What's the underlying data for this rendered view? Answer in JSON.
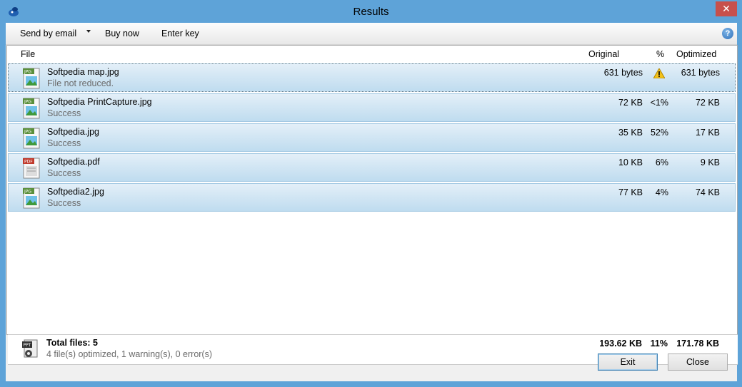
{
  "window": {
    "title": "Results",
    "close_label": "✕"
  },
  "toolbar": {
    "send_email": "Send by email",
    "buy_now": "Buy now",
    "enter_key": "Enter key",
    "help": "?"
  },
  "columns": {
    "file": "File",
    "original": "Original",
    "percent": "%",
    "optimized": "Optimized"
  },
  "files": [
    {
      "name": "Softpedia map.jpg",
      "status": "File not reduced.",
      "original": "631 bytes",
      "percent": "",
      "optimized": "631 bytes",
      "type": "JPG",
      "warning": true
    },
    {
      "name": "Softpedia PrintCapture.jpg",
      "status": "Success",
      "original": "72 KB",
      "percent": "<1%",
      "optimized": "72 KB",
      "type": "JPG"
    },
    {
      "name": "Softpedia.jpg",
      "status": "Success",
      "original": "35 KB",
      "percent": "52%",
      "optimized": "17 KB",
      "type": "JPG"
    },
    {
      "name": "Softpedia.pdf",
      "status": "Success",
      "original": "10 KB",
      "percent": "6%",
      "optimized": "9 KB",
      "type": "PDF"
    },
    {
      "name": "Softpedia2.jpg",
      "status": "Success",
      "original": "77 KB",
      "percent": "4%",
      "optimized": "74 KB",
      "type": "JPG"
    }
  ],
  "summary": {
    "total": "Total files: 5",
    "detail": "4 file(s) optimized, 1 warning(s), 0 error(s)",
    "original": "193.62 KB",
    "percent": "11%",
    "optimized": "171.78 KB",
    "icon_label": "PPT"
  },
  "buttons": {
    "exit": "Exit",
    "close": "Close"
  },
  "colors": {
    "titlebar": "#5ea3d8",
    "row_selected": "#bfdcef",
    "close_button": "#c7504c"
  }
}
